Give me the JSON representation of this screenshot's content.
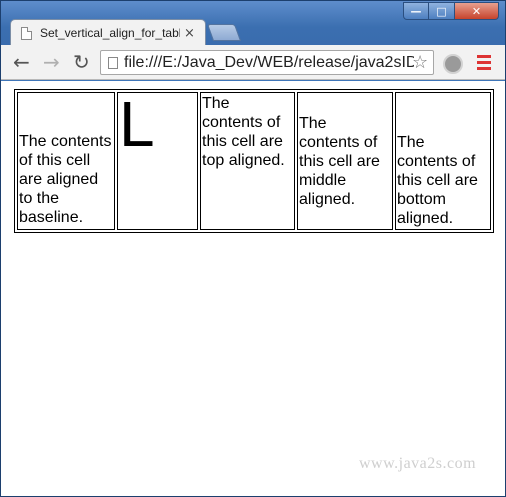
{
  "browser": {
    "tab_title": "Set_vertical_align_for_tabl",
    "tab_close": "×",
    "url": "file:///E:/Java_Dev/WEB/release/java2sID",
    "window_controls": {
      "minimize": "—",
      "maximize": "□",
      "close": "✕"
    },
    "nav": {
      "back": "←",
      "forward": "→",
      "reload": "↻"
    },
    "star": "☆"
  },
  "table": {
    "cells": [
      "The contents of this cell are aligned to the baseline.",
      "L",
      "The contents of this cell are top aligned.",
      "The contents of this cell are middle aligned.",
      "The contents of this cell are bottom aligned."
    ]
  },
  "watermark": "www.java2s.com"
}
